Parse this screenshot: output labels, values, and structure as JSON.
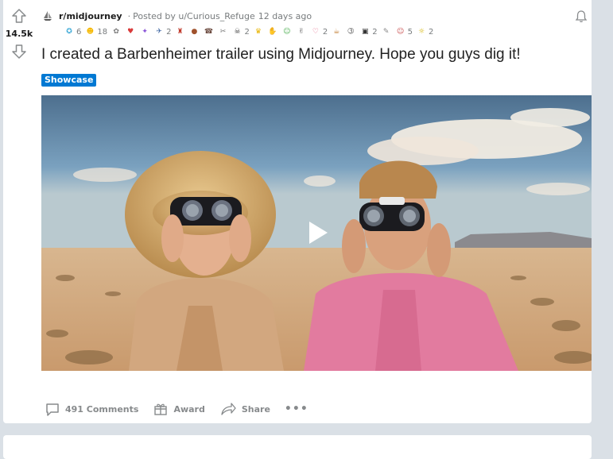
{
  "post": {
    "score": "14.5k",
    "subreddit": "r/midjourney",
    "posted_by": "Posted by u/Curious_Refuge",
    "time_ago": "12 days ago",
    "title": "I created a Barbenheimer trailer using Midjourney. Hope you guys dig it!",
    "flair": "Showcase",
    "flair_color": "#0079d3",
    "awards": [
      {
        "icon": "helpful-award-icon",
        "glyph": "✪",
        "color": "#39a8d6",
        "count": "6"
      },
      {
        "icon": "wholesome-award-icon",
        "glyph": "☻",
        "color": "#f5b800",
        "count": "18"
      },
      {
        "icon": "award-icon",
        "glyph": "✿",
        "color": "#7a7a7a",
        "count": ""
      },
      {
        "icon": "award-icon",
        "glyph": "♥",
        "color": "#d93a3a",
        "count": ""
      },
      {
        "icon": "award-icon",
        "glyph": "✦",
        "color": "#8a55d8",
        "count": ""
      },
      {
        "icon": "award-icon",
        "glyph": "✈",
        "color": "#4a6fa8",
        "count": "2"
      },
      {
        "icon": "award-icon",
        "glyph": "♜",
        "color": "#c0392b",
        "count": ""
      },
      {
        "icon": "award-icon",
        "glyph": "●",
        "color": "#a0522d",
        "count": ""
      },
      {
        "icon": "award-icon",
        "glyph": "☎",
        "color": "#6d4c41",
        "count": ""
      },
      {
        "icon": "award-icon",
        "glyph": "✂",
        "color": "#777777",
        "count": ""
      },
      {
        "icon": "award-icon",
        "glyph": "☠",
        "color": "#444444",
        "count": "2"
      },
      {
        "icon": "award-icon",
        "glyph": "♛",
        "color": "#e8b400",
        "count": ""
      },
      {
        "icon": "award-icon",
        "glyph": "✋",
        "color": "#555555",
        "count": ""
      },
      {
        "icon": "award-icon",
        "glyph": "☺",
        "color": "#4caf50",
        "count": ""
      },
      {
        "icon": "award-icon",
        "glyph": "✌",
        "color": "#555555",
        "count": ""
      },
      {
        "icon": "award-icon",
        "glyph": "♡",
        "color": "#e05577",
        "count": "2"
      },
      {
        "icon": "award-icon",
        "glyph": "☕",
        "color": "#c07a2b",
        "count": ""
      },
      {
        "icon": "award-icon",
        "glyph": "➂",
        "color": "#555555",
        "count": ""
      },
      {
        "icon": "award-icon",
        "glyph": "▣",
        "color": "#333333",
        "count": "2"
      },
      {
        "icon": "award-icon",
        "glyph": "✎",
        "color": "#888888",
        "count": ""
      },
      {
        "icon": "award-icon",
        "glyph": "☺",
        "color": "#c94f4f",
        "count": "5"
      },
      {
        "icon": "award-icon",
        "glyph": "☼",
        "color": "#d4b400",
        "count": "2"
      }
    ]
  },
  "actions": {
    "comments": "491 Comments",
    "award": "Award",
    "share": "Share",
    "more": "•••"
  }
}
